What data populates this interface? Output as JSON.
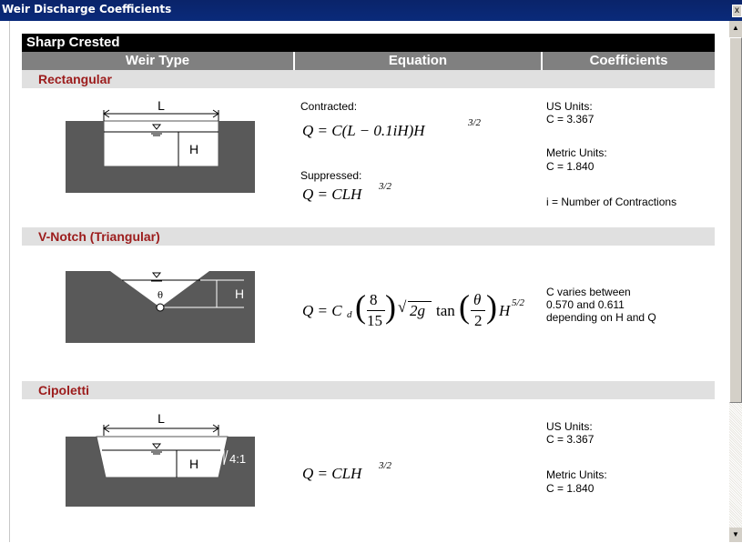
{
  "window": {
    "title": "Weir Discharge Coefficients",
    "close": "x"
  },
  "table": {
    "header": "Sharp Crested",
    "columns": [
      "Weir Type",
      "Equation",
      "Coefficients"
    ]
  },
  "sections": [
    {
      "name": "Rectangular",
      "diagram_labels": {
        "L": "L",
        "H": "H"
      },
      "eq1_label": "Contracted:",
      "eq1": "Q = C(L − 0.1iH)H",
      "eq1_exp": "3/2",
      "eq2_label": "Suppressed:",
      "eq2": "Q = CLH",
      "eq2_exp": "3/2",
      "coef": [
        "US Units:",
        "C = 3.367",
        "Metric Units:",
        "C = 1.840",
        "i = Number of Contractions"
      ]
    },
    {
      "name": "V-Notch (Triangular)",
      "diagram_labels": {
        "theta": "θ",
        "H": "H"
      },
      "eq": {
        "q": "Q = C",
        "sub": "d",
        "num": "8",
        "den": "15",
        "sqrt": "2g",
        "tan": "tan",
        "thnum": "θ",
        "thden": "2",
        "h": "H",
        "exp": "5/2"
      },
      "coef": [
        "C varies between",
        "0.570 and 0.611",
        "depending on H and Q"
      ]
    },
    {
      "name": "Cipoletti",
      "diagram_labels": {
        "L": "L",
        "H": "H",
        "slope": "4:1"
      },
      "eq1": "Q = CLH",
      "eq1_exp": "3/2",
      "coef": [
        "US Units:",
        "C = 3.367",
        "Metric Units:",
        "C = 1.840"
      ]
    }
  ]
}
